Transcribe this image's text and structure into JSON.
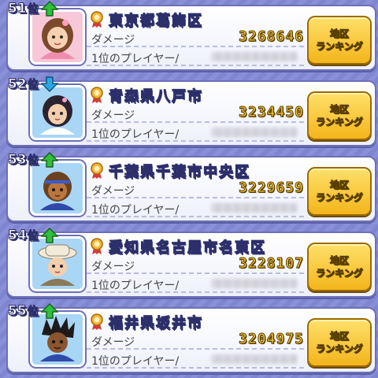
{
  "rows": [
    {
      "rank": "51",
      "rank_suffix": "位",
      "trend": "up",
      "region": "東京都葛飾区",
      "damage_label": "ダメージ",
      "damage": "3268646",
      "player_label": "1位のプレイヤー/",
      "button_line1": "地区",
      "button_line2": "ランキング",
      "avatar": {
        "hair": "#7a4a2a",
        "skin": "#f6d2b2",
        "shirt": "#f08cb0",
        "bg": "#f6c8d8"
      }
    },
    {
      "rank": "52",
      "rank_suffix": "位",
      "trend": "down",
      "region": "青森県八戸市",
      "damage_label": "ダメージ",
      "damage": "3234450",
      "player_label": "1位のプレイヤー/",
      "button_line1": "地区",
      "button_line2": "ランキング",
      "avatar": {
        "hair": "#2b2230",
        "skin": "#f3cfae",
        "shirt": "#ffffff",
        "bg": "#a9d6f5"
      }
    },
    {
      "rank": "53",
      "rank_suffix": "位",
      "trend": "up",
      "region": "千葉県千葉市中央区",
      "damage_label": "ダメージ",
      "damage": "3229659",
      "player_label": "1位のプレイヤー/",
      "button_line1": "地区",
      "button_line2": "ランキング",
      "avatar": {
        "hair": "#6b4220",
        "skin": "#b9773f",
        "shirt": "#2f4aa8",
        "bg": "#a9d6f5"
      }
    },
    {
      "rank": "54",
      "rank_suffix": "位",
      "trend": "up",
      "region": "愛知県名古屋市名東区",
      "damage_label": "ダメージ",
      "damage": "3228107",
      "player_label": "1位のプレイヤー/",
      "button_line1": "地区",
      "button_line2": "ランキング",
      "avatar": {
        "hair": "#f2ead8",
        "skin": "#f3cfae",
        "shirt": "#8a7a5a",
        "bg": "#a9d6f5"
      }
    },
    {
      "rank": "55",
      "rank_suffix": "位",
      "trend": "up",
      "region": "福井県坂井市",
      "damage_label": "ダメージ",
      "damage": "3204975",
      "player_label": "1位のプレイヤー/",
      "button_line1": "地区",
      "button_line2": "ランキング",
      "avatar": {
        "hair": "#1e1a1a",
        "skin": "#8a5530",
        "shirt": "#2f4aa8",
        "bg": "#a9d6f5"
      }
    }
  ],
  "colors": {
    "trend_up": "#2fbf3a",
    "trend_down": "#2aa7e0",
    "damage_gold": "#f7c531",
    "button_gold": "#f3b51c"
  }
}
